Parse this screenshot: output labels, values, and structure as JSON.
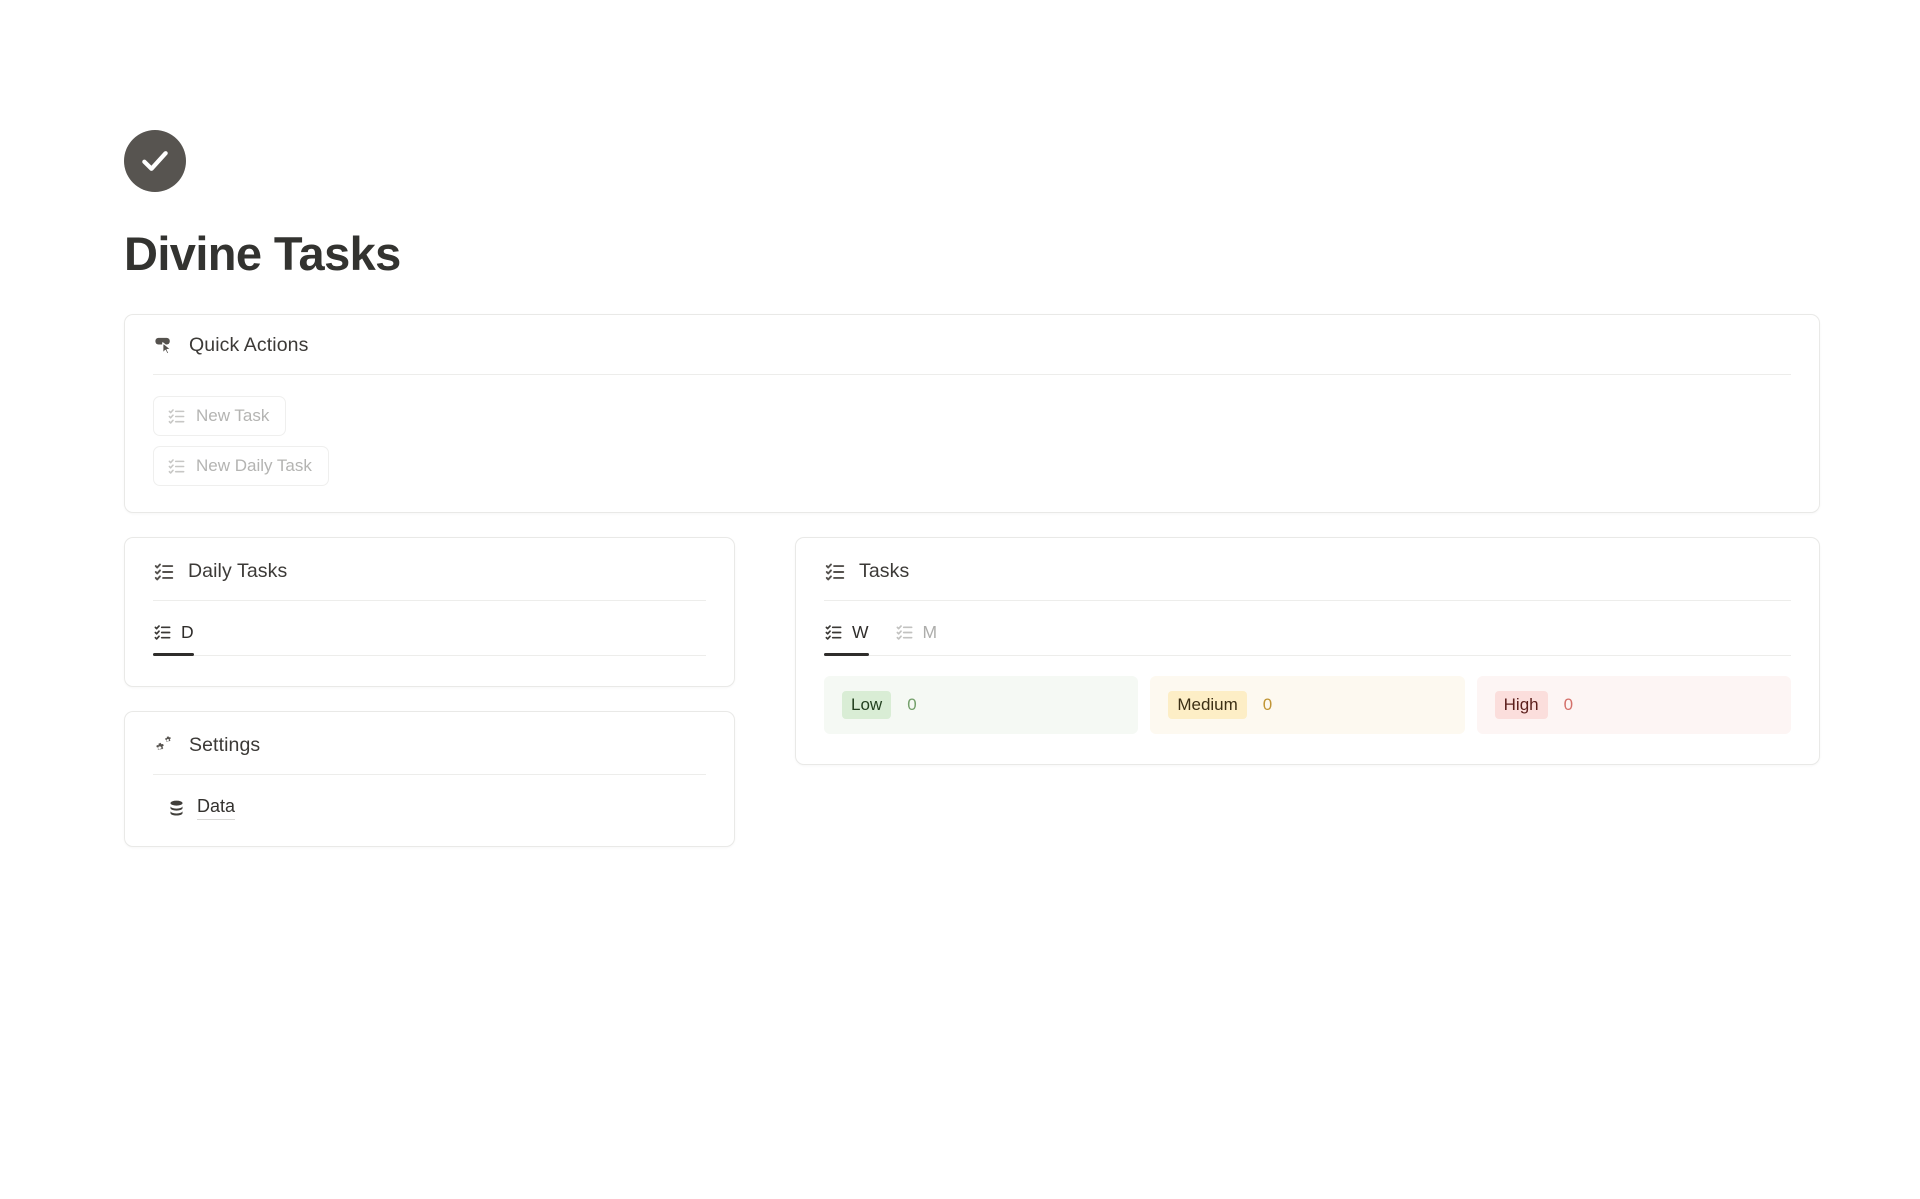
{
  "app": {
    "title": "Divine Tasks",
    "logo_icon": "check-circle-icon",
    "logo_color": "#575450"
  },
  "quick_actions": {
    "icon": "mouse-pointer-click-icon",
    "title": "Quick Actions",
    "buttons": [
      {
        "label": "New Task",
        "icon": "list-checks-icon"
      },
      {
        "label": "New Daily Task",
        "icon": "list-checks-icon"
      }
    ]
  },
  "daily_tasks": {
    "icon": "list-checks-icon",
    "title": "Daily Tasks",
    "tabs": [
      {
        "label": "D",
        "icon": "list-checks-icon",
        "active": true
      }
    ]
  },
  "settings": {
    "icon": "cogs-icon",
    "title": "Settings",
    "links": [
      {
        "label": "Data",
        "icon": "database-icon"
      }
    ]
  },
  "tasks": {
    "icon": "list-checks-icon",
    "title": "Tasks",
    "tabs": [
      {
        "label": "W",
        "icon": "list-checks-icon",
        "active": true
      },
      {
        "label": "M",
        "icon": "list-checks-icon",
        "active": false
      }
    ],
    "priorities": [
      {
        "label": "Low",
        "count": "0",
        "badge_bg": "#d9edd5",
        "badge_text": "#23401f",
        "panel_bg": "#f5f9f4",
        "count_color": "#74a06b"
      },
      {
        "label": "Medium",
        "count": "0",
        "badge_bg": "#fdeec6",
        "badge_text": "#3c2f14",
        "panel_bg": "#fdf9f0",
        "count_color": "#c09536"
      },
      {
        "label": "High",
        "count": "0",
        "badge_bg": "#fbdedc",
        "badge_text": "#5c1f1c",
        "panel_bg": "#fdf5f4",
        "count_color": "#d4706a"
      }
    ]
  }
}
